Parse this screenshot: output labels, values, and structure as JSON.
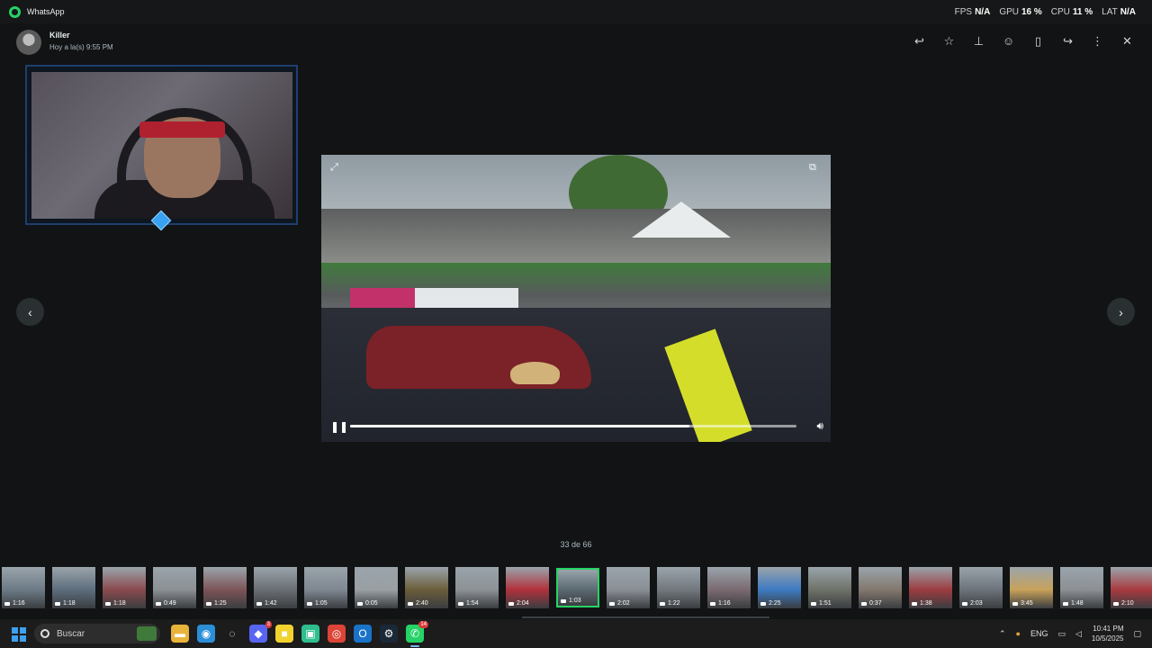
{
  "app": {
    "title": "WhatsApp"
  },
  "perf": [
    {
      "label": "FPS",
      "value": "N/A"
    },
    {
      "label": "GPU",
      "value": "16 %"
    },
    {
      "label": "CPU",
      "value": "11 %"
    },
    {
      "label": "LAT",
      "value": "N/A"
    }
  ],
  "header": {
    "sender": "Killer",
    "time": "Hoy a la(s) 9:55 PM"
  },
  "video": {
    "progress": 0.76
  },
  "counter": "33 de 66",
  "thumbnails": [
    {
      "duration": "1:16",
      "color": "#6c7a86"
    },
    {
      "duration": "1:18",
      "color": "#5d6d7d"
    },
    {
      "duration": "1:18",
      "color": "#8a4a4e"
    },
    {
      "duration": "0:49",
      "color": "#8b9094"
    },
    {
      "duration": "1:25",
      "color": "#7d5458"
    },
    {
      "duration": "1:42",
      "color": "#6a6e74"
    },
    {
      "duration": "1:05",
      "color": "#7f8791"
    },
    {
      "duration": "0:05",
      "color": "#9aa0a4"
    },
    {
      "duration": "2:40",
      "color": "#6b5d3a"
    },
    {
      "duration": "1:54",
      "color": "#8c9296"
    },
    {
      "duration": "2:04",
      "color": "#b0313c"
    },
    {
      "duration": "1:03",
      "color": "#5b6a72",
      "selected": true
    },
    {
      "duration": "2:02",
      "color": "#8a8f96"
    },
    {
      "duration": "1:22",
      "color": "#72787e"
    },
    {
      "duration": "1:16",
      "color": "#7a6a70"
    },
    {
      "duration": "2:25",
      "color": "#3e7ac2"
    },
    {
      "duration": "1:51",
      "color": "#6e7268"
    },
    {
      "duration": "0:37",
      "color": "#83786e"
    },
    {
      "duration": "1:38",
      "color": "#9c3c40"
    },
    {
      "duration": "2:03",
      "color": "#6d737a"
    },
    {
      "duration": "3:45",
      "color": "#c8a25a"
    },
    {
      "duration": "1:48",
      "color": "#8c9094"
    },
    {
      "duration": "2:10",
      "color": "#a83a40"
    }
  ],
  "taskbar": {
    "search_label": "Buscar",
    "apps": [
      {
        "icon": "file-explorer-icon",
        "glyph": "▬",
        "color": "#e8b33a"
      },
      {
        "icon": "edge-icon",
        "glyph": "◉",
        "color": "#2a8fd6"
      },
      {
        "icon": "app-ring-icon",
        "glyph": "◌",
        "color": "#ffffff"
      },
      {
        "icon": "discord-icon",
        "glyph": "◆",
        "color": "#5865f2",
        "badge": "3"
      },
      {
        "icon": "sticky-notes-icon",
        "glyph": "■",
        "color": "#f2d22e"
      },
      {
        "icon": "app-green-icon",
        "glyph": "▣",
        "color": "#2fbf8f"
      },
      {
        "icon": "chrome-icon",
        "glyph": "◎",
        "color": "#db4437"
      },
      {
        "icon": "outlook-icon",
        "glyph": "O",
        "color": "#1a73c8"
      },
      {
        "icon": "steam-icon",
        "glyph": "⚙",
        "color": "#1b2838"
      },
      {
        "icon": "whatsapp-icon",
        "glyph": "✆",
        "color": "#25d366",
        "badge": "14"
      }
    ],
    "language": "ENG",
    "time": "10:41 PM",
    "date": "10/5/2025"
  }
}
